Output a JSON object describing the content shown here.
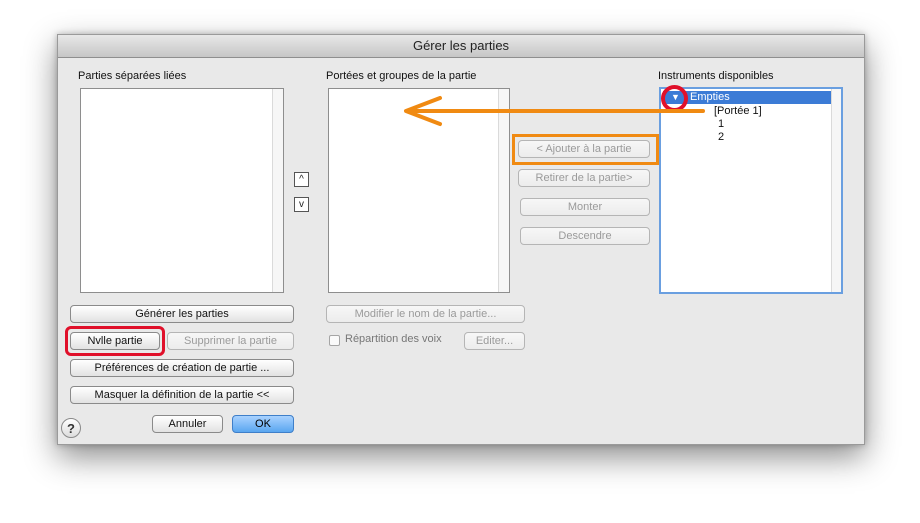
{
  "dialog": {
    "title": "Gérer les parties"
  },
  "left_panel": {
    "heading": "Parties séparées liées",
    "generate_button": "Générer les parties",
    "new_part_button": "Nvlle partie",
    "delete_part_button": "Supprimer la partie",
    "preferences_button": "Préférences de création de partie ...",
    "hide_definition_button": "Masquer la définition de la partie <<",
    "cancel_button": "Annuler",
    "ok_button": "OK",
    "help_glyph": "?",
    "up_glyph": "^",
    "down_glyph": "v"
  },
  "middle_panel": {
    "heading": "Portées et groupes de la partie",
    "rename_button": "Modifier le nom de la partie...",
    "voice_split_label": "Répartition des voix",
    "edit_button": "Editer..."
  },
  "actions": {
    "add_button": "< Ajouter à la partie",
    "remove_button": "Retirer de la partie>",
    "up_button": "Monter",
    "down_button": "Descendre"
  },
  "right_panel": {
    "heading": "Instruments disponibles",
    "tree": {
      "root": "Empties",
      "staff": "[Portée 1]",
      "voices": [
        "1",
        "2"
      ]
    }
  },
  "annotations": {
    "red": "#e0102a",
    "orange": "#f08a12"
  }
}
